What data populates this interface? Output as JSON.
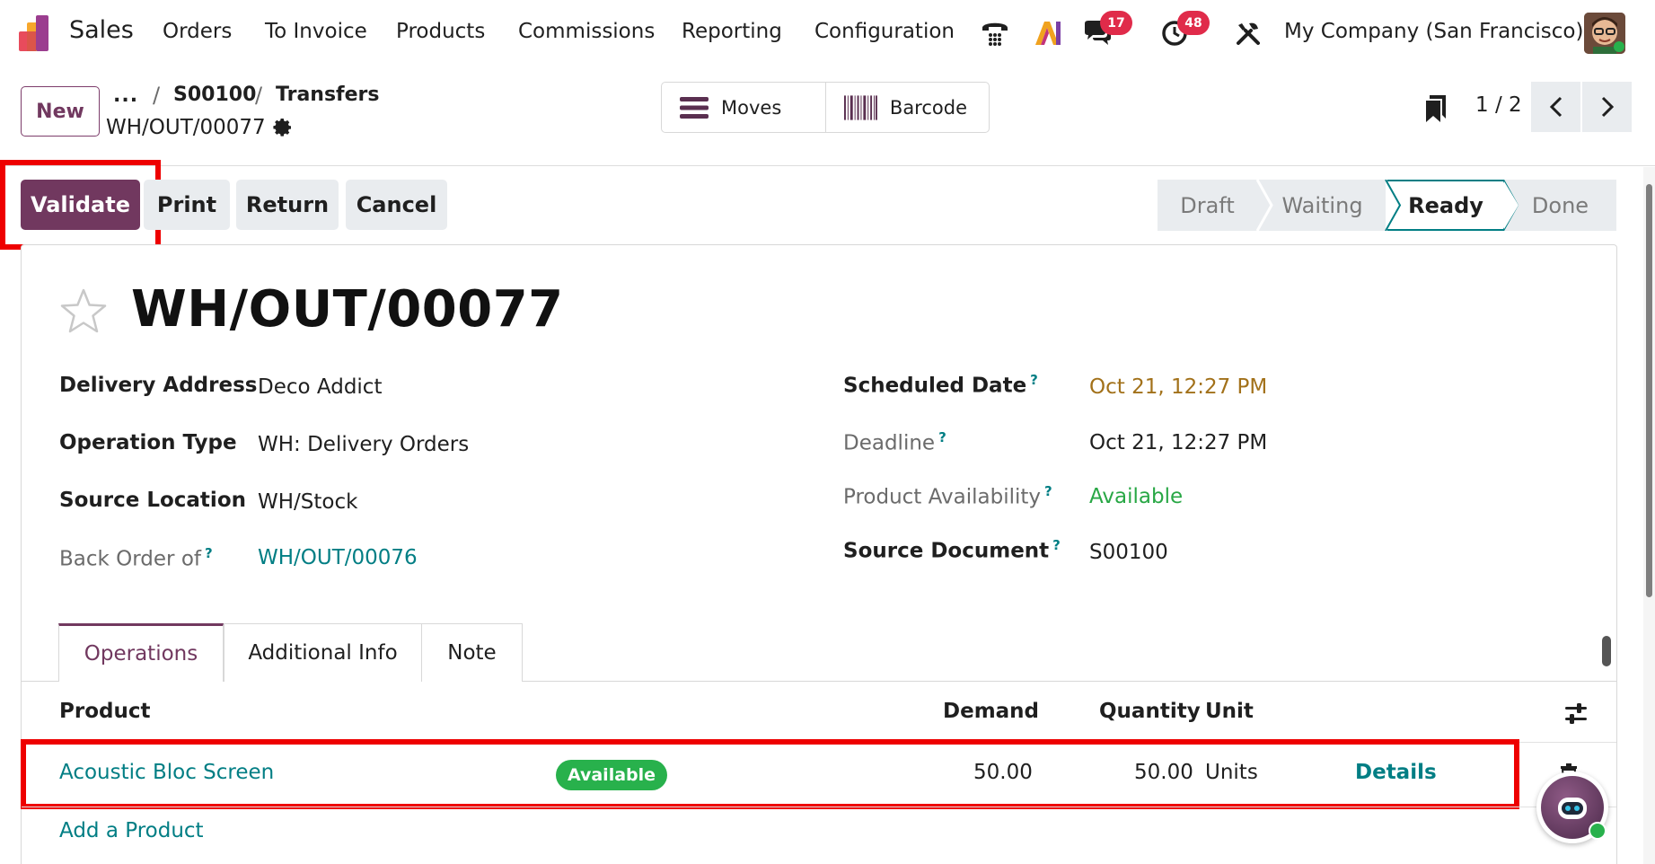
{
  "navbar": {
    "app_name": "Sales",
    "menu": [
      "Orders",
      "To Invoice",
      "Products",
      "Commissions",
      "Reporting",
      "Configuration"
    ],
    "messages_badge": "17",
    "activities_badge": "48",
    "company": "My Company (San Francisco)"
  },
  "control_panel": {
    "new_label": "New",
    "breadcrumb_dots": "...",
    "breadcrumb": [
      "S00100",
      "Transfers"
    ],
    "record_name": "WH/OUT/00077",
    "smart_buttons": [
      "Moves",
      "Barcode"
    ],
    "pager": "1 / 2"
  },
  "actions": {
    "validate": "Validate",
    "print": "Print",
    "return": "Return",
    "cancel": "Cancel"
  },
  "statusbar": {
    "stages": [
      "Draft",
      "Waiting",
      "Ready",
      "Done"
    ],
    "active": "Ready"
  },
  "form": {
    "title": "WH/OUT/00077",
    "left_fields": [
      {
        "label": "Delivery Address",
        "value": "Deco Addict"
      },
      {
        "label": "Operation Type",
        "value": "WH: Delivery Orders"
      },
      {
        "label": "Source Location",
        "value": "WH/Stock"
      },
      {
        "label": "Back Order of",
        "value": "WH/OUT/00076"
      }
    ],
    "right_fields": [
      {
        "label": "Scheduled Date",
        "value": "Oct 21, 12:27 PM"
      },
      {
        "label": "Deadline",
        "value": "Oct 21, 12:27 PM"
      },
      {
        "label": "Product Availability",
        "value": "Available"
      },
      {
        "label": "Source Document",
        "value": "S00100"
      }
    ],
    "help_mark": "?"
  },
  "tabs": [
    "Operations",
    "Additional Info",
    "Note"
  ],
  "operations": {
    "headers": {
      "product": "Product",
      "demand": "Demand",
      "quantity": "Quantity",
      "unit": "Unit"
    },
    "rows": [
      {
        "product": "Acoustic Bloc Screen",
        "availability": "Available",
        "demand": "50.00",
        "quantity": "50.00",
        "unit": "Units",
        "details": "Details"
      }
    ],
    "add_product": "Add a Product"
  },
  "colors": {
    "brand": "#71385f",
    "link": "#017e84",
    "highlight": "#ee0000",
    "badge": "#e02b4a",
    "available": "#28b14c"
  }
}
